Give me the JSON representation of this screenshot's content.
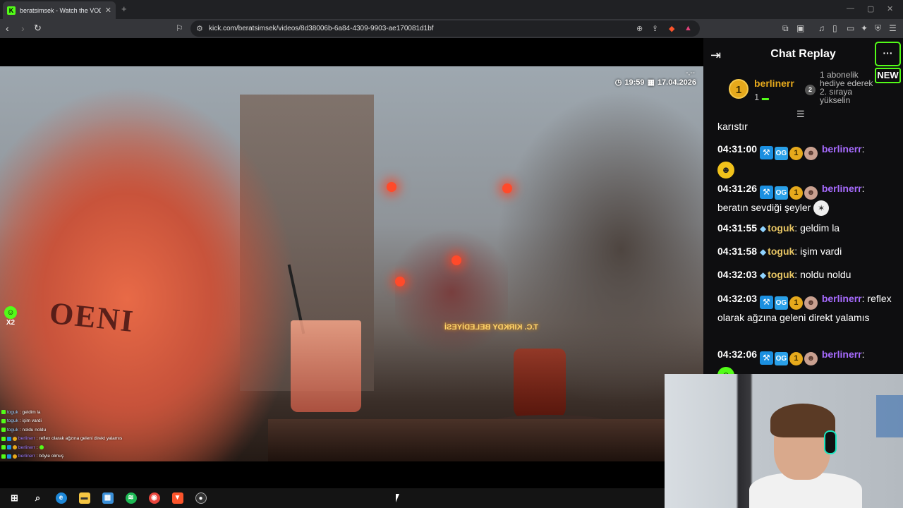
{
  "browser": {
    "tab_title": "beratsimsek - Watch the VOD",
    "new_tab_glyph": "+",
    "url": "kick.com/beratsimsek/videos/8d38006b-6a84-4309-9903-ae170081d1bf",
    "window_controls": [
      "—",
      "▢",
      "✕"
    ]
  },
  "video": {
    "hud_time": "19:59",
    "hud_date": "17.04.2026",
    "hud_top": "-,--",
    "sign_text": "T.C. KIRKDY BELEDİYESİ",
    "overlay_emote_count": "X2",
    "mini_chat": [
      {
        "user": "toguk",
        "text": ": geldim la",
        "style": "plain"
      },
      {
        "user": "toguk",
        "text": ": işim vardi",
        "style": "plain"
      },
      {
        "user": "toguk",
        "text": ": noldu noldu",
        "style": "plain"
      },
      {
        "user": "berlinerr",
        "text": ": reflex olarak ağzına geleni direkt yalamıs",
        "style": "badged"
      },
      {
        "user": "berlinerr",
        "text": ":",
        "style": "badged-emote"
      },
      {
        "user": "berlinerr",
        "text": ": böyle olmuş",
        "style": "badged"
      }
    ]
  },
  "chat": {
    "title": "Chat Replay",
    "more_label": "···",
    "new_label": "NEW",
    "leaderboard": {
      "rank1": "1",
      "user": "berlinerr",
      "count": "1",
      "rank2": "2",
      "promo": "1 abonelik hediye ederek 2. sıraya yükselin"
    },
    "messages": [
      {
        "time": "",
        "user": "",
        "text": "karıstır"
      },
      {
        "time": "04:31:00",
        "user": "berlinerr",
        "text": ""
      },
      {
        "time": "04:31:26",
        "user": "berlinerr",
        "text": "beratın sevdiği şeyler"
      },
      {
        "time": "04:31:55",
        "user": "toguk",
        "text": "geldim la"
      },
      {
        "time": "04:31:58",
        "user": "toguk",
        "text": "işim vardi"
      },
      {
        "time": "04:32:03",
        "user": "toguk",
        "text": "noldu noldu"
      },
      {
        "time": "04:32:03",
        "user": "berlinerr",
        "text": "reflex olarak ağzına geleni direkt yalamıs"
      },
      {
        "time": "04:32:06",
        "user": "berlinerr",
        "text": ""
      }
    ]
  },
  "icons": {
    "mod_badge": "⚒",
    "og_badge": "OG",
    "coin_badge": "1",
    "diamond_badge": "◆",
    "avatar_badge": "☻"
  },
  "colors": {
    "kick_green": "#53fc18",
    "chat_bg": "#0e0e10",
    "user_purple": "#a76bff",
    "user_gold": "#e6c463"
  }
}
